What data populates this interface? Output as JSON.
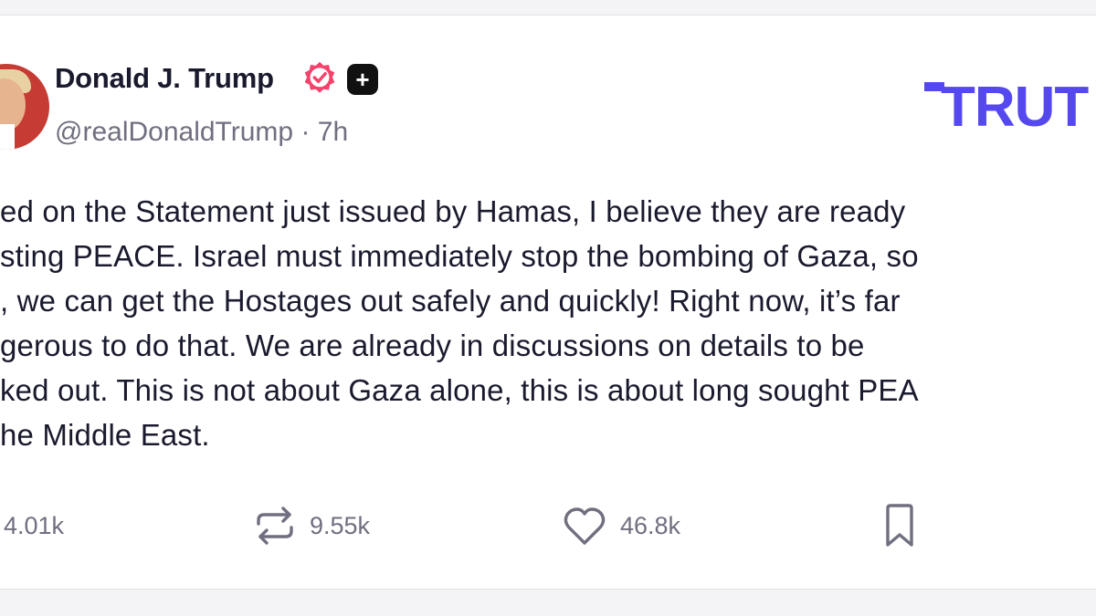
{
  "post": {
    "author_name": "Donald J. Trump",
    "handle": "@realDonaldTrump",
    "time_separator": "·",
    "time": "7h",
    "plus_badge": "+",
    "brand_logo": "TRUT",
    "body_lines": [
      "ed on the Statement just issued by Hamas, I believe they are ready",
      "sting PEACE. Israel must immediately stop the bombing of Gaza, so",
      ", we can get the Hostages out safely and quickly! Right now, it’s far",
      "gerous to do that. We are already in discussions on details to be",
      "ked out. This is not about Gaza alone, this is about long sought PEA",
      "he Middle East."
    ]
  },
  "actions": {
    "replies": "4.01k",
    "retruths": "9.55k",
    "likes": "46.8k"
  },
  "colors": {
    "brand": "#5448ee",
    "verified": "#f5426c",
    "text": "#1a1a2e",
    "muted": "#6f6f80"
  },
  "icons": [
    "verified-icon",
    "plus-badge-icon",
    "retruth-icon",
    "heart-icon",
    "bookmark-icon"
  ]
}
